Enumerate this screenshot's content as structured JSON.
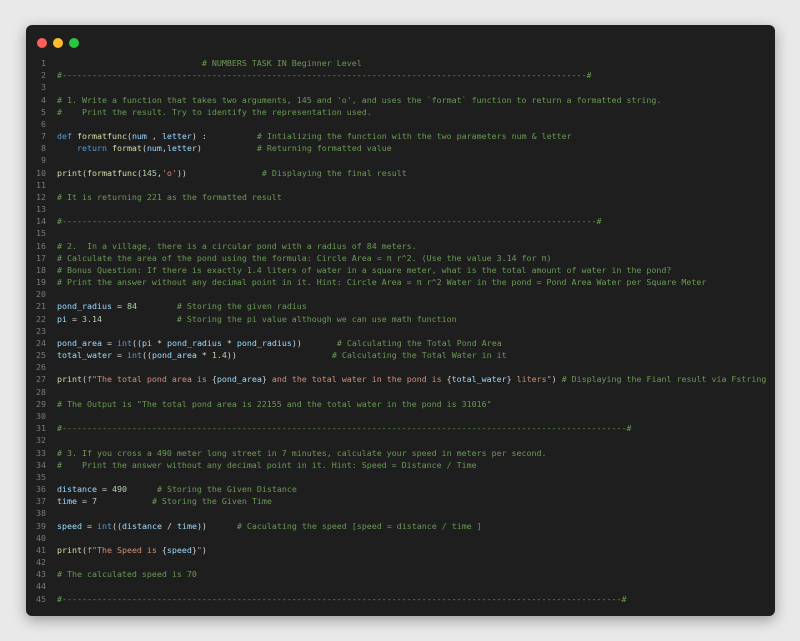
{
  "window": {
    "controls": [
      "close",
      "minimize",
      "maximize"
    ]
  },
  "lines": [
    {
      "n": "1",
      "tokens": [
        {
          "c": "cm",
          "t": "                             # NUMBERS TASK IN Beginner Level"
        }
      ]
    },
    {
      "n": "2",
      "tokens": [
        {
          "c": "cm",
          "t": "#---------------------------------------------------------------------------------------------------------#"
        }
      ]
    },
    {
      "n": "3",
      "tokens": []
    },
    {
      "n": "4",
      "tokens": [
        {
          "c": "cm",
          "t": "# 1. Write a function that takes two arguments, 145 and 'o', and uses the `format` function to return a formatted string."
        }
      ]
    },
    {
      "n": "5",
      "tokens": [
        {
          "c": "cm",
          "t": "#    Print the result. Try to identify the representation used."
        }
      ]
    },
    {
      "n": "6",
      "tokens": []
    },
    {
      "n": "7",
      "tokens": [
        {
          "c": "kw",
          "t": "def "
        },
        {
          "c": "fn",
          "t": "formatfunc"
        },
        {
          "c": "text",
          "t": "("
        },
        {
          "c": "var",
          "t": "num"
        },
        {
          "c": "text",
          "t": " , "
        },
        {
          "c": "var",
          "t": "letter"
        },
        {
          "c": "text",
          "t": ") :          "
        },
        {
          "c": "cm",
          "t": "# Intializing the function with the two parameters num & letter"
        }
      ]
    },
    {
      "n": "8",
      "tokens": [
        {
          "c": "text",
          "t": "    "
        },
        {
          "c": "kw",
          "t": "return "
        },
        {
          "c": "fn",
          "t": "format"
        },
        {
          "c": "text",
          "t": "("
        },
        {
          "c": "var",
          "t": "num"
        },
        {
          "c": "text",
          "t": ","
        },
        {
          "c": "var",
          "t": "letter"
        },
        {
          "c": "text",
          "t": ")           "
        },
        {
          "c": "cm",
          "t": "# Returning formatted value"
        }
      ]
    },
    {
      "n": "9",
      "tokens": []
    },
    {
      "n": "10",
      "tokens": [
        {
          "c": "fn",
          "t": "print"
        },
        {
          "c": "text",
          "t": "("
        },
        {
          "c": "fn",
          "t": "formatfunc"
        },
        {
          "c": "text",
          "t": "("
        },
        {
          "c": "num",
          "t": "145"
        },
        {
          "c": "text",
          "t": ","
        },
        {
          "c": "st",
          "t": "'o'"
        },
        {
          "c": "text",
          "t": "))               "
        },
        {
          "c": "cm",
          "t": "# Displaying the final result"
        }
      ]
    },
    {
      "n": "11",
      "tokens": []
    },
    {
      "n": "12",
      "tokens": [
        {
          "c": "cm",
          "t": "# It is returning 221 as the formatted result"
        }
      ]
    },
    {
      "n": "13",
      "tokens": []
    },
    {
      "n": "14",
      "tokens": [
        {
          "c": "cm",
          "t": "#-----------------------------------------------------------------------------------------------------------#"
        }
      ]
    },
    {
      "n": "15",
      "tokens": []
    },
    {
      "n": "16",
      "tokens": [
        {
          "c": "cm",
          "t": "# 2.  In a village, there is a circular pond with a radius of 84 meters."
        }
      ]
    },
    {
      "n": "17",
      "tokens": [
        {
          "c": "cm",
          "t": "# Calculate the area of the pond using the formula: Circle Area = π r^2. (Use the value 3.14 for π)"
        }
      ]
    },
    {
      "n": "18",
      "tokens": [
        {
          "c": "cm",
          "t": "# Bonus Question: If there is exactly 1.4 liters of water in a square meter, what is the total amount of water in the pond?"
        }
      ]
    },
    {
      "n": "19",
      "tokens": [
        {
          "c": "cm",
          "t": "# Print the answer without any decimal point in it. Hint: Circle Area = π r^2 Water in the pond = Pond Area Water per Square Meter"
        }
      ]
    },
    {
      "n": "20",
      "tokens": []
    },
    {
      "n": "21",
      "tokens": [
        {
          "c": "var",
          "t": "pond_radius"
        },
        {
          "c": "text",
          "t": " = "
        },
        {
          "c": "num",
          "t": "84"
        },
        {
          "c": "text",
          "t": "        "
        },
        {
          "c": "cm",
          "t": "# Storing the given radius"
        }
      ]
    },
    {
      "n": "22",
      "tokens": [
        {
          "c": "var",
          "t": "pi"
        },
        {
          "c": "text",
          "t": " = "
        },
        {
          "c": "num",
          "t": "3.14"
        },
        {
          "c": "text",
          "t": "               "
        },
        {
          "c": "cm",
          "t": "# Storing the pi value although we can use math function"
        }
      ]
    },
    {
      "n": "23",
      "tokens": []
    },
    {
      "n": "24",
      "tokens": [
        {
          "c": "var",
          "t": "pond_area"
        },
        {
          "c": "text",
          "t": " = "
        },
        {
          "c": "kw",
          "t": "int"
        },
        {
          "c": "text",
          "t": "(("
        },
        {
          "c": "var",
          "t": "pi"
        },
        {
          "c": "text",
          "t": " * "
        },
        {
          "c": "var",
          "t": "pond_radius"
        },
        {
          "c": "text",
          "t": " * "
        },
        {
          "c": "var",
          "t": "pond_radius"
        },
        {
          "c": "text",
          "t": "))       "
        },
        {
          "c": "cm",
          "t": "# Calculating the Total Pond Area"
        }
      ]
    },
    {
      "n": "25",
      "tokens": [
        {
          "c": "var",
          "t": "total_water"
        },
        {
          "c": "text",
          "t": " = "
        },
        {
          "c": "kw",
          "t": "int"
        },
        {
          "c": "text",
          "t": "(("
        },
        {
          "c": "var",
          "t": "pond_area"
        },
        {
          "c": "text",
          "t": " * "
        },
        {
          "c": "num",
          "t": "1.4"
        },
        {
          "c": "text",
          "t": "))                   "
        },
        {
          "c": "cm",
          "t": "# Calculating the Total Water in it"
        }
      ]
    },
    {
      "n": "26",
      "tokens": []
    },
    {
      "n": "27",
      "tokens": [
        {
          "c": "fn",
          "t": "print"
        },
        {
          "c": "text",
          "t": "("
        },
        {
          "c": "st",
          "t": "f\"The total pond area is "
        },
        {
          "c": "text",
          "t": "{"
        },
        {
          "c": "var",
          "t": "pond_area"
        },
        {
          "c": "text",
          "t": "}"
        },
        {
          "c": "st",
          "t": " and the total water in the pond is "
        },
        {
          "c": "text",
          "t": "{"
        },
        {
          "c": "var",
          "t": "total_water"
        },
        {
          "c": "text",
          "t": "}"
        },
        {
          "c": "st",
          "t": " liters\""
        },
        {
          "c": "text",
          "t": ") "
        },
        {
          "c": "cm",
          "t": "# Displaying the Fianl result via Fstring"
        }
      ]
    },
    {
      "n": "28",
      "tokens": []
    },
    {
      "n": "29",
      "tokens": [
        {
          "c": "cm",
          "t": "# The Output is \"The total pond area is 22155 and the total water in the pond is 31016\""
        }
      ]
    },
    {
      "n": "30",
      "tokens": []
    },
    {
      "n": "31",
      "tokens": [
        {
          "c": "cm",
          "t": "#-----------------------------------------------------------------------------------------------------------------#"
        }
      ]
    },
    {
      "n": "32",
      "tokens": []
    },
    {
      "n": "33",
      "tokens": [
        {
          "c": "cm",
          "t": "# 3. If you cross a 490 meter long street in 7 minutes, calculate your speed in meters per second."
        }
      ]
    },
    {
      "n": "34",
      "tokens": [
        {
          "c": "cm",
          "t": "#    Print the answer without any decimal point in it. Hint: Speed = Distance / Time"
        }
      ]
    },
    {
      "n": "35",
      "tokens": []
    },
    {
      "n": "36",
      "tokens": [
        {
          "c": "var",
          "t": "distance"
        },
        {
          "c": "text",
          "t": " = "
        },
        {
          "c": "num",
          "t": "490"
        },
        {
          "c": "text",
          "t": "      "
        },
        {
          "c": "cm",
          "t": "# Storing the Given Distance"
        }
      ]
    },
    {
      "n": "37",
      "tokens": [
        {
          "c": "var",
          "t": "time"
        },
        {
          "c": "text",
          "t": " = "
        },
        {
          "c": "num",
          "t": "7"
        },
        {
          "c": "text",
          "t": "           "
        },
        {
          "c": "cm",
          "t": "# Storing the Given Time"
        }
      ]
    },
    {
      "n": "38",
      "tokens": []
    },
    {
      "n": "39",
      "tokens": [
        {
          "c": "var",
          "t": "speed"
        },
        {
          "c": "text",
          "t": " = "
        },
        {
          "c": "kw",
          "t": "int"
        },
        {
          "c": "text",
          "t": "(("
        },
        {
          "c": "var",
          "t": "distance"
        },
        {
          "c": "text",
          "t": " / "
        },
        {
          "c": "var",
          "t": "time"
        },
        {
          "c": "text",
          "t": "))      "
        },
        {
          "c": "cm",
          "t": "# Caculating the speed [speed = distance / time ]"
        }
      ]
    },
    {
      "n": "40",
      "tokens": []
    },
    {
      "n": "41",
      "tokens": [
        {
          "c": "fn",
          "t": "print"
        },
        {
          "c": "text",
          "t": "("
        },
        {
          "c": "st",
          "t": "f\"The Speed is "
        },
        {
          "c": "text",
          "t": "{"
        },
        {
          "c": "var",
          "t": "speed"
        },
        {
          "c": "text",
          "t": "}"
        },
        {
          "c": "st",
          "t": "\""
        },
        {
          "c": "text",
          "t": ")"
        }
      ]
    },
    {
      "n": "42",
      "tokens": []
    },
    {
      "n": "43",
      "tokens": [
        {
          "c": "cm",
          "t": "# The calculated speed is 70"
        }
      ]
    },
    {
      "n": "44",
      "tokens": []
    },
    {
      "n": "45",
      "tokens": [
        {
          "c": "cm",
          "t": "#----------------------------------------------------------------------------------------------------------------#"
        }
      ]
    }
  ]
}
